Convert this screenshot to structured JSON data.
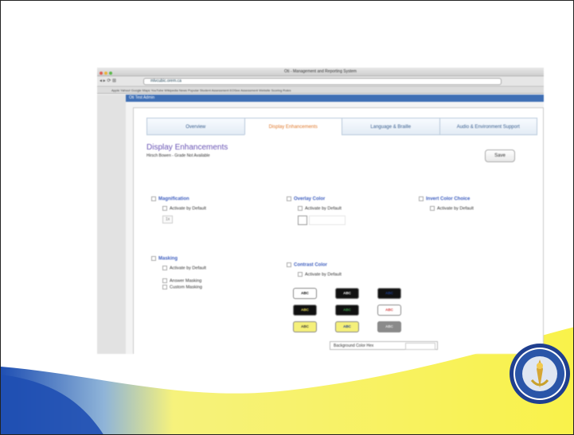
{
  "browser": {
    "window_title": "Oti - Management and Reporting System",
    "url": "mlvcubic.orem.ca",
    "bookmarks": "Apple   Yahoo!   Google Maps   YouTube   Wikipedia   News   Popular   Student Assessment   EOSee   Assessment   Website   Scoring Rules",
    "app_header": "Oti Test Admin"
  },
  "tabs": [
    "Overview",
    "Display Enhancements",
    "Language & Braille",
    "Audio & Environment Support"
  ],
  "panel": {
    "title": "Display Enhancements",
    "subtitle": "Hirsch Bowen - Grade Not Available",
    "save_label": "Save"
  },
  "sections": {
    "magnification": {
      "label": "Magnification",
      "option": "Activate by Default",
      "value": "1x"
    },
    "overlay": {
      "label": "Overlay Color",
      "option": "Activate by Default"
    },
    "invert": {
      "label": "Invert Color Choice",
      "option": "Activate by Default"
    },
    "masking": {
      "label": "Masking",
      "option": "Activate by Default",
      "answer": "Answer Masking",
      "custom": "Custom Masking"
    },
    "contrast": {
      "label": "Contrast Color",
      "option": "Activate by Default",
      "bg_hex_label": "Background Color Hex"
    }
  },
  "swatches": [
    {
      "text": "ABC",
      "bg": "#ffffff",
      "fg": "#000000"
    },
    {
      "text": "ABC",
      "bg": "#111111",
      "fg": "#ffffff"
    },
    {
      "text": "ABC",
      "bg": "#111111",
      "fg": "#1d3e8e"
    },
    {
      "text": "ABC",
      "bg": "#111111",
      "fg": "#f2e55a"
    },
    {
      "text": "ABC",
      "bg": "#111111",
      "fg": "#3ea04a"
    },
    {
      "text": "ABC",
      "bg": "#ffffff",
      "fg": "#d33a3a"
    },
    {
      "text": "ABC",
      "bg": "#f5f07a",
      "fg": "#333333"
    },
    {
      "text": "ABC",
      "bg": "#f5f07a",
      "fg": "#1a3a8e"
    },
    {
      "text": "ABC",
      "bg": "#8a8a8a",
      "fg": "#e9e9e9"
    }
  ],
  "colors": {
    "accent_blue": "#3f6fb5",
    "active_tab": "#e07a2e",
    "title_purple": "#6a55b5",
    "wave_blue": "#1f4fb3",
    "wave_yellow": "#f7f27a"
  },
  "logo": {
    "name": "seal-icon",
    "text": "STATE DEPARTMENT OF EDUCATION"
  }
}
